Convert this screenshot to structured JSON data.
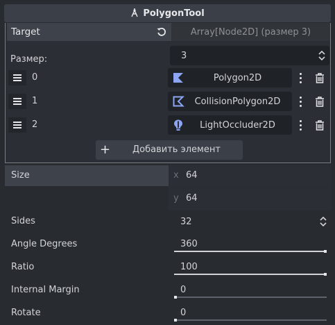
{
  "header": {
    "title": "PolygonTool",
    "icon": "polygon-tool-icon"
  },
  "array": {
    "target_label": "Target",
    "target_value": "Array[Node2D] (размер 3)",
    "size_label": "Размер:",
    "size_value": "3",
    "elements": [
      {
        "index": "0",
        "node": "Polygon2D",
        "icon": "polygon2d-icon"
      },
      {
        "index": "1",
        "node": "CollisionPolygon2D",
        "icon": "collision-polygon2d-icon"
      },
      {
        "index": "2",
        "node": "LightOccluder2D",
        "icon": "light-occluder2d-icon"
      }
    ],
    "add_label": "Добавить элемент"
  },
  "props": {
    "size": {
      "label": "Size",
      "x_axis": "x",
      "x": "64",
      "y_axis": "y",
      "y": "64"
    },
    "sides": {
      "label": "Sides",
      "value": "32"
    },
    "angle": {
      "label": "Angle Degrees",
      "value": "360",
      "fill": 1.0
    },
    "ratio": {
      "label": "Ratio",
      "value": "100",
      "fill": 1.0
    },
    "margin": {
      "label": "Internal Margin",
      "value": "0",
      "fill": 0.0
    },
    "rotate": {
      "label": "Rotate",
      "value": "0",
      "fill": 0.0
    }
  },
  "colors": {
    "polygon_icon": "#8da5f3",
    "accent_bg": "#3e424a",
    "field_bg": "#1f2226"
  }
}
